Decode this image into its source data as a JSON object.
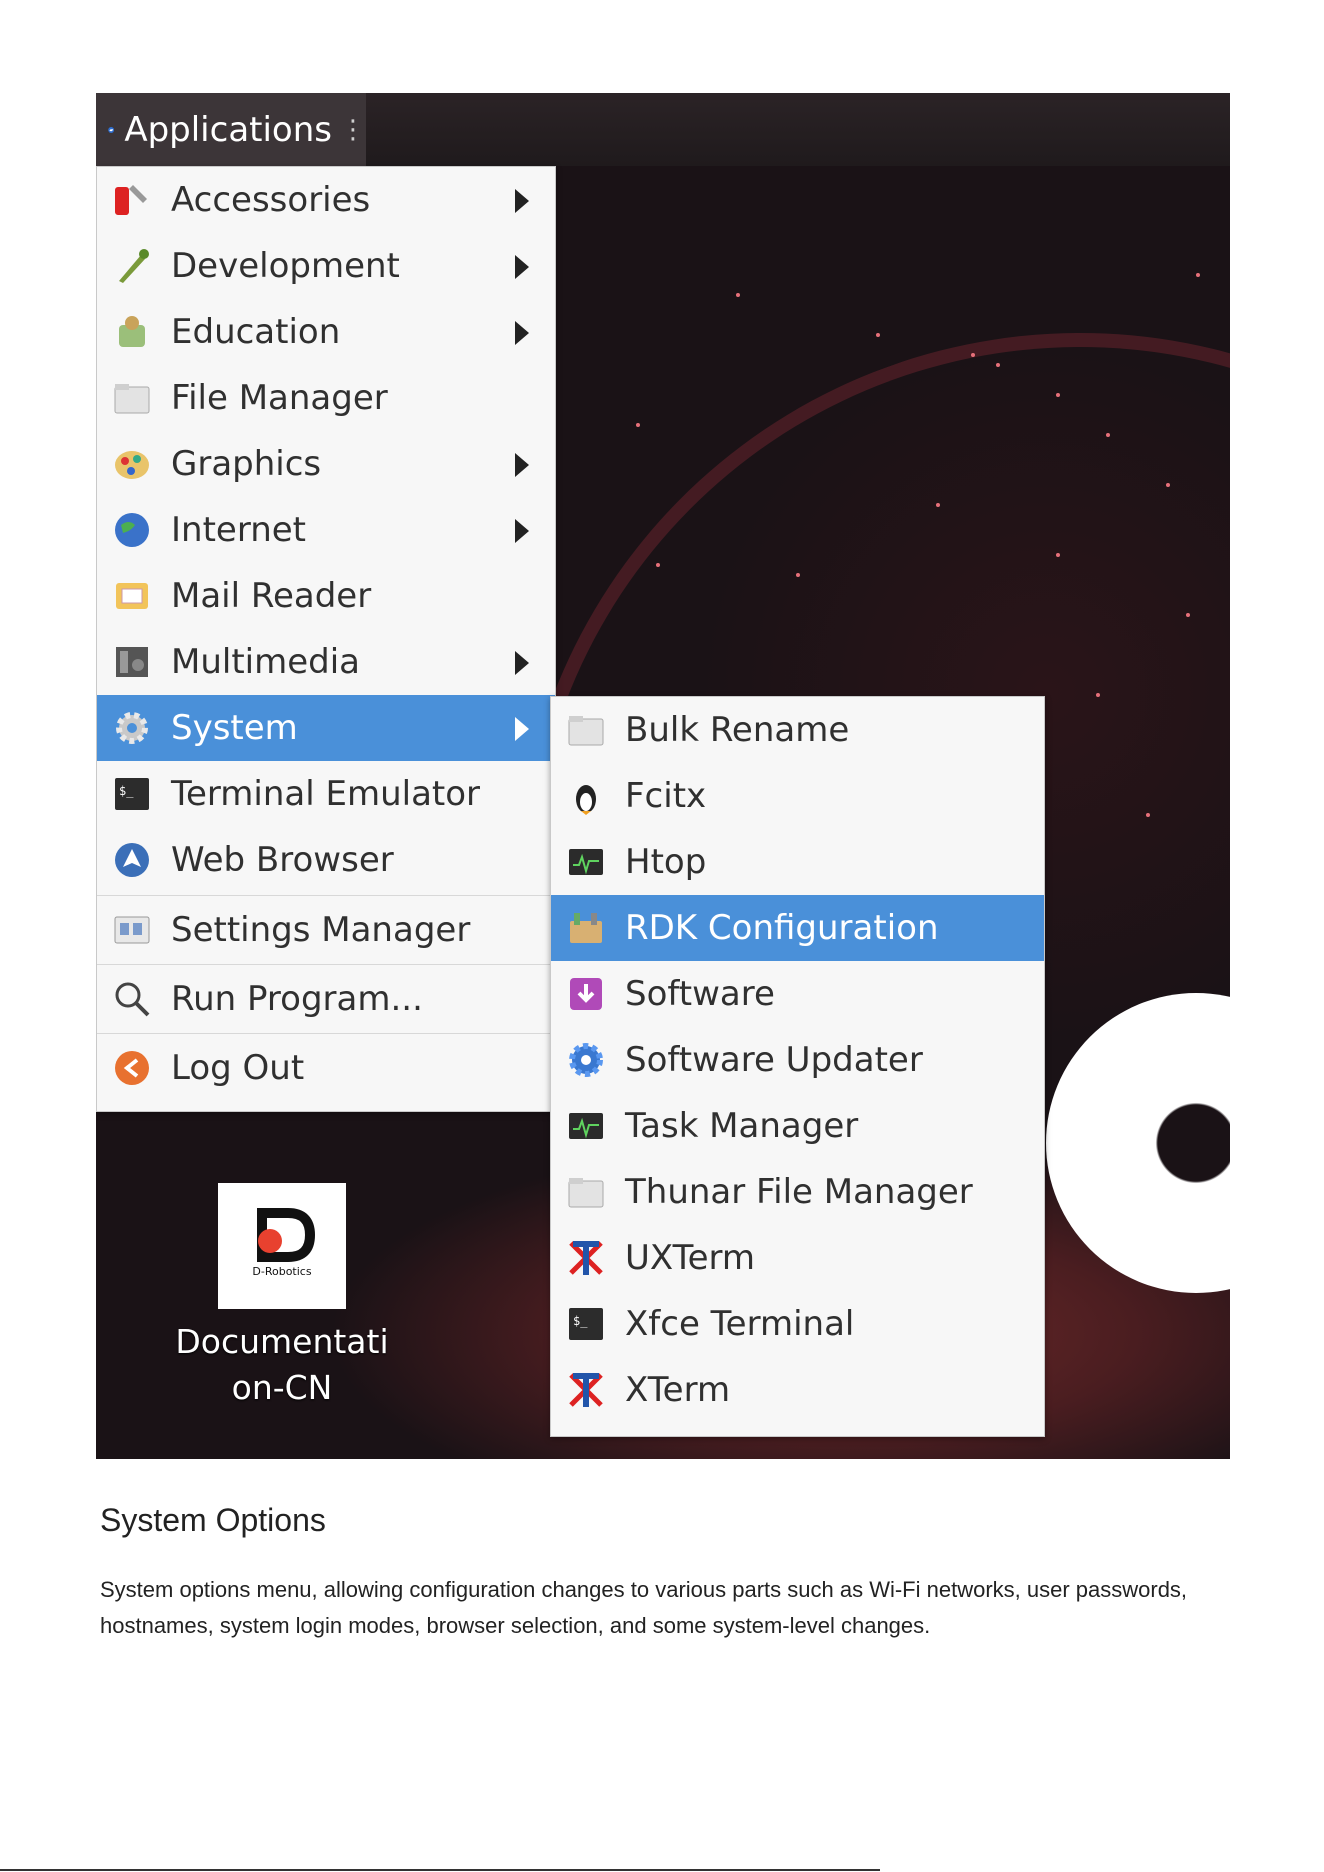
{
  "panel": {
    "applications_label": "Applications"
  },
  "main_menu": {
    "items": [
      {
        "label": "Accessories",
        "icon": "accessories-icon",
        "submenu": true
      },
      {
        "label": "Development",
        "icon": "development-icon",
        "submenu": true
      },
      {
        "label": "Education",
        "icon": "education-icon",
        "submenu": true
      },
      {
        "label": "File Manager",
        "icon": "folder-icon",
        "submenu": false
      },
      {
        "label": "Graphics",
        "icon": "graphics-icon",
        "submenu": true
      },
      {
        "label": "Internet",
        "icon": "globe-icon",
        "submenu": true
      },
      {
        "label": "Mail Reader",
        "icon": "mail-icon",
        "submenu": false
      },
      {
        "label": "Multimedia",
        "icon": "multimedia-icon",
        "submenu": true
      },
      {
        "label": "System",
        "icon": "gear-icon",
        "submenu": true,
        "selected": true
      },
      {
        "label": "Terminal Emulator",
        "icon": "terminal-icon",
        "submenu": false
      },
      {
        "label": "Web Browser",
        "icon": "web-browser-icon",
        "submenu": false
      },
      {
        "label": "Settings Manager",
        "icon": "settings-icon",
        "submenu": false
      },
      {
        "label": "Run Program...",
        "icon": "search-icon",
        "submenu": false
      },
      {
        "label": "Log Out",
        "icon": "logout-icon",
        "submenu": false
      }
    ]
  },
  "system_submenu": {
    "items": [
      {
        "label": "Bulk Rename",
        "icon": "folder-icon"
      },
      {
        "label": "Fcitx",
        "icon": "penguin-icon"
      },
      {
        "label": "Htop",
        "icon": "monitor-icon"
      },
      {
        "label": "RDK Configuration",
        "icon": "config-icon",
        "selected": true
      },
      {
        "label": "Software",
        "icon": "software-icon"
      },
      {
        "label": "Software Updater",
        "icon": "updater-icon"
      },
      {
        "label": "Task Manager",
        "icon": "monitor-icon"
      },
      {
        "label": "Thunar File Manager",
        "icon": "folder-icon"
      },
      {
        "label": "UXTerm",
        "icon": "xterm-icon"
      },
      {
        "label": "Xfce Terminal",
        "icon": "terminal-icon"
      },
      {
        "label": "XTerm",
        "icon": "xterm-icon"
      }
    ]
  },
  "desktop": {
    "doc_icon_brand": "D-Robotics",
    "doc_icon_label_line1": "Documentati",
    "doc_icon_label_line2": "on-CN"
  },
  "caption": {
    "title": "System Options",
    "body": "System options menu, allowing configuration changes to various parts such as Wi-Fi networks, user passwords, hostnames, system login modes, browser selection, and some system-level changes."
  },
  "colors": {
    "selection": "#4a90d9",
    "menu_bg": "#f7f7f7",
    "panel_bg": "#2b2326"
  }
}
